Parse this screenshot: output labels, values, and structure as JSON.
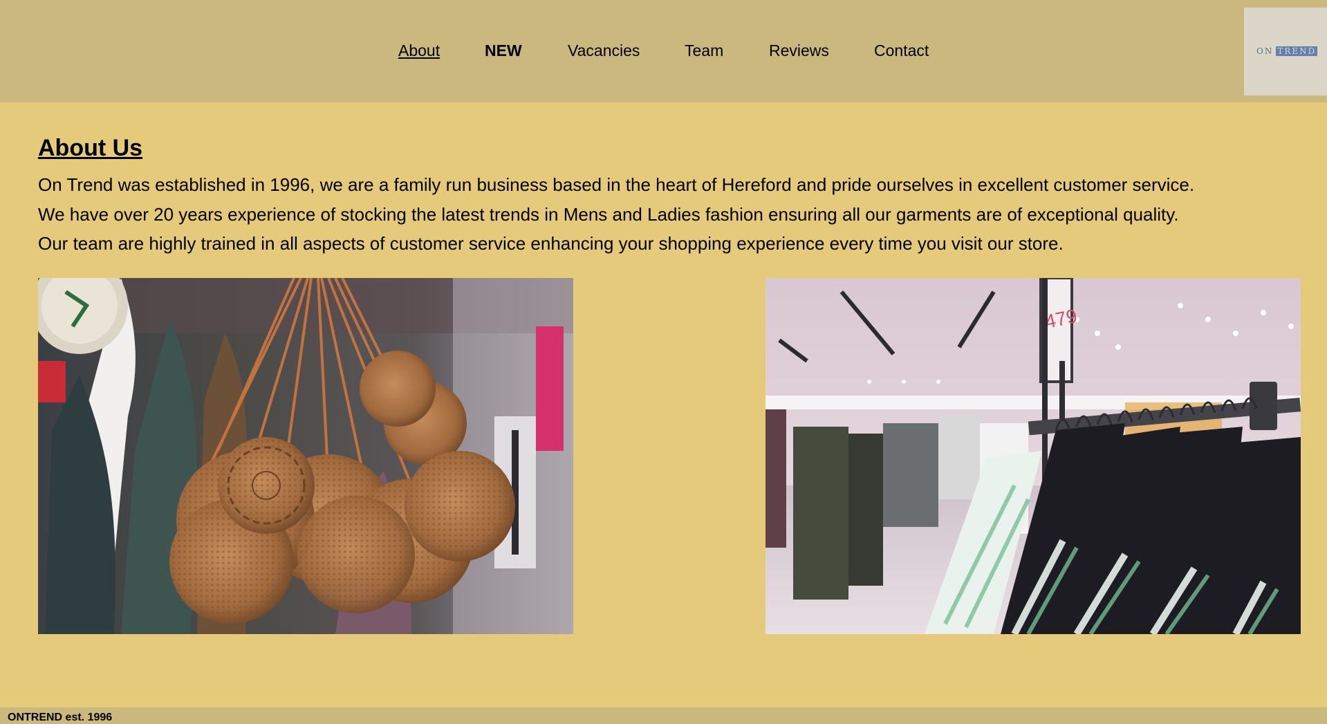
{
  "nav": {
    "items": [
      {
        "label": "About"
      },
      {
        "label": "NEW"
      },
      {
        "label": "Vacancies"
      },
      {
        "label": "Team"
      },
      {
        "label": "Reviews"
      },
      {
        "label": "Contact"
      }
    ]
  },
  "logo": {
    "on": "ON",
    "trend": "TREND"
  },
  "main": {
    "title": "About Us",
    "paragraphs": [
      "On Trend was established in 1996, we are a family run business based in the heart of Hereford and pride ourselves in excellent customer service.",
      "We have over 20 years experience of stocking the latest trends in Mens and Ladies fashion ensuring all our garments are of exceptional quality.",
      "Our team are highly trained in all aspects of customer service enhancing your shopping experience every time you visit our store."
    ],
    "price_sign": "479"
  },
  "footer": {
    "text": "ONTREND est. 1996"
  },
  "colors": {
    "header_bg": "#cab87e",
    "page_bg": "#e4ca7a",
    "logo_bg": "#dcd6c9",
    "logo_accent": "#6381ad"
  }
}
